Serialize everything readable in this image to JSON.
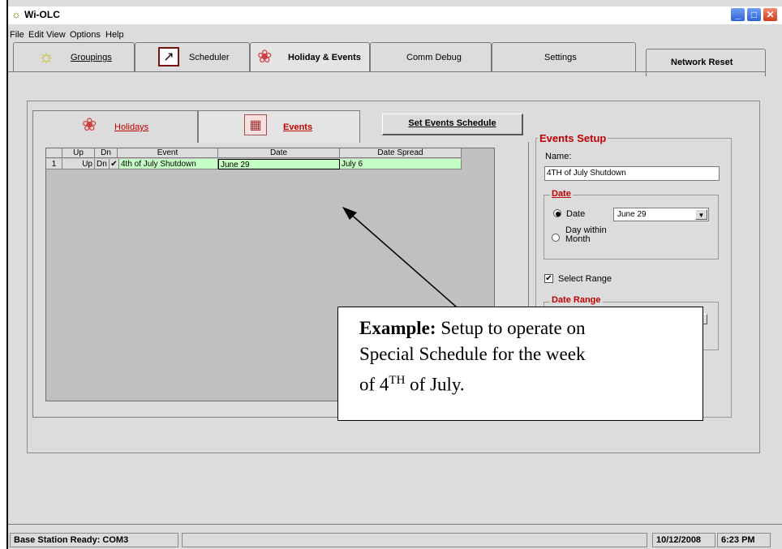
{
  "app": {
    "title": "Wi-OLC"
  },
  "menu": [
    "File",
    "Edit",
    "View",
    "Options",
    "Help"
  ],
  "tabs": [
    {
      "label": "Groupings"
    },
    {
      "label": "Scheduler"
    },
    {
      "label": "Holiday & Events"
    },
    {
      "label": "Comm Debug"
    },
    {
      "label": "Settings"
    },
    {
      "label": "Network Reset"
    }
  ],
  "subtabs": [
    {
      "label": "Holidays"
    },
    {
      "label": "Events"
    }
  ],
  "set_events_button": "Set Events Schedule",
  "grid": {
    "headers": [
      "Up",
      "Dn",
      "Event",
      "Date",
      "Date Spread"
    ],
    "rows": [
      {
        "num": "1",
        "up": "Up",
        "dn": "Dn",
        "checked": "✔",
        "event": "4th of July Shutdown",
        "date": "June 29",
        "spread": "July 6"
      }
    ]
  },
  "events_setup": {
    "title": "Events Setup",
    "name_label": "Name:",
    "name_value": "4TH of July Shutdown",
    "date_group_title": "Date",
    "radio_date": "Date",
    "radio_day_within": "Day within",
    "radio_month": "Month",
    "date_value": "June    29",
    "select_range": "Select Range",
    "date_range_title": "Date Range"
  },
  "callout": {
    "bold": "Example:",
    "line1": " Setup to operate on",
    "line2": "Special Schedule for the week",
    "line3a": "of  4",
    "sup": "TH",
    "line3b": " of July."
  },
  "status": {
    "text": "Base Station Ready: COM3",
    "date": "10/12/2008",
    "time": "6:23 PM"
  },
  "colors": {
    "grid_row": "#c5ffc5",
    "accent_red": "#c00000",
    "titlebar_btn": "#2f62d8"
  }
}
